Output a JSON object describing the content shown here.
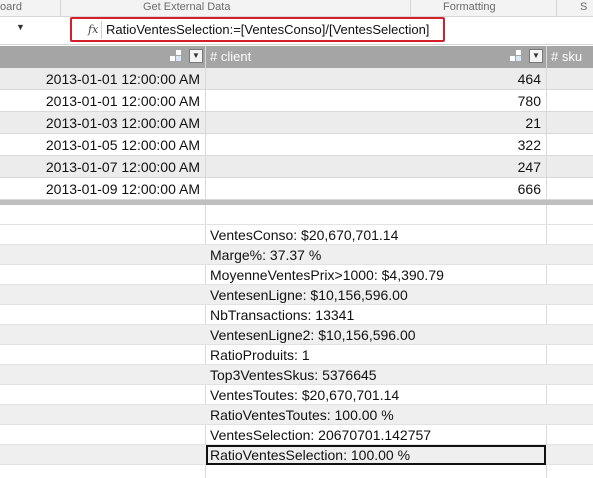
{
  "ribbon": {
    "groups": [
      "oard",
      "Get External Data",
      "Formatting",
      "S"
    ]
  },
  "formula_bar": {
    "fx_label": "fx",
    "formula": "RatioVentesSelection:=[VentesConso]/[VentesSelection]",
    "highlight_color": "#d4202a"
  },
  "table": {
    "columns": [
      "",
      "# client",
      "# sku"
    ],
    "rows": [
      {
        "date": "2013-01-01 12:00:00 AM",
        "client": "464"
      },
      {
        "date": "2013-01-01 12:00:00 AM",
        "client": "780"
      },
      {
        "date": "2013-01-03 12:00:00 AM",
        "client": "21"
      },
      {
        "date": "2013-01-05 12:00:00 AM",
        "client": "322"
      },
      {
        "date": "2013-01-07 12:00:00 AM",
        "client": "247"
      },
      {
        "date": "2013-01-09 12:00:00 AM",
        "client": "666"
      }
    ]
  },
  "measures": [
    "VentesConso: $20,670,701.14",
    "Marge%: 37.37 %",
    "MoyenneVentesPrix>1000: $4,390.79",
    "VentesenLigne: $10,156,596.00",
    "NbTransactions: 13341",
    "VentesenLigne2: $10,156,596.00",
    "RatioProduits: 1",
    "Top3VentesSkus: 5376645",
    "VentesToutes: $20,670,701.14",
    "RatioVentesToutes: 100.00 %",
    "VentesSelection: 20670701.142757",
    "RatioVentesSelection: 100.00 %"
  ]
}
